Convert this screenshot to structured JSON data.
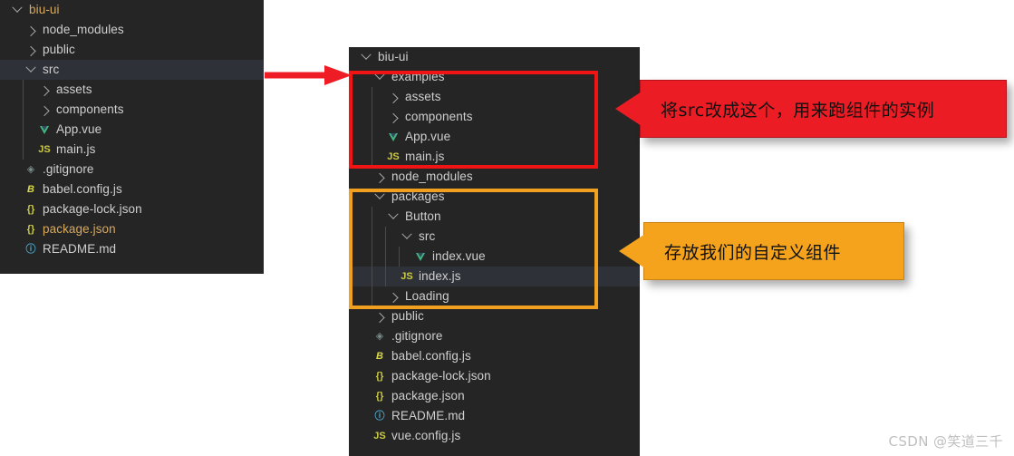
{
  "colors": {
    "panel_bg": "#252526",
    "row_selected": "#2f3138",
    "text": "#cccccc",
    "root_folder": "#d7a95f",
    "highlight_red": "#f01414",
    "highlight_orange": "#f0a01e",
    "callout_red_bg": "#ec1c24",
    "callout_orange_bg": "#f5a31c",
    "vue_icon": "#41b883",
    "js_icon": "#cbcb41"
  },
  "left_panel": {
    "name": "before-explorer",
    "rows": [
      {
        "label": "biu-ui",
        "depth": 0,
        "kind": "folder-open",
        "icon": "chevron-down-icon",
        "color": "root",
        "selected": false
      },
      {
        "label": "node_modules",
        "depth": 1,
        "kind": "folder",
        "icon": "chevron-right-icon",
        "color": "folder",
        "selected": false
      },
      {
        "label": "public",
        "depth": 1,
        "kind": "folder",
        "icon": "chevron-right-icon",
        "color": "folder",
        "selected": false
      },
      {
        "label": "src",
        "depth": 1,
        "kind": "folder-open",
        "icon": "chevron-down-icon",
        "color": "folder",
        "selected": true
      },
      {
        "label": "assets",
        "depth": 2,
        "kind": "folder",
        "icon": "chevron-right-icon",
        "color": "folder",
        "selected": false
      },
      {
        "label": "components",
        "depth": 2,
        "kind": "folder",
        "icon": "chevron-right-icon",
        "color": "folder",
        "selected": false
      },
      {
        "label": "App.vue",
        "depth": 2,
        "kind": "file",
        "icon": "vue-file-icon",
        "color": "file",
        "selected": false
      },
      {
        "label": "main.js",
        "depth": 2,
        "kind": "file",
        "icon": "js-file-icon",
        "color": "file",
        "selected": false
      },
      {
        "label": ".gitignore",
        "depth": 1,
        "kind": "file",
        "icon": "git-file-icon",
        "color": "file",
        "selected": false
      },
      {
        "label": "babel.config.js",
        "depth": 1,
        "kind": "file",
        "icon": "babel-file-icon",
        "color": "file",
        "selected": false
      },
      {
        "label": "package-lock.json",
        "depth": 1,
        "kind": "file",
        "icon": "json-file-icon",
        "color": "file",
        "selected": false
      },
      {
        "label": "package.json",
        "depth": 1,
        "kind": "file",
        "icon": "json-file-icon",
        "color": "pkg",
        "selected": false
      },
      {
        "label": "README.md",
        "depth": 1,
        "kind": "file",
        "icon": "markdown-file-icon",
        "color": "file",
        "selected": false
      }
    ]
  },
  "right_panel": {
    "name": "after-explorer",
    "rows": [
      {
        "label": "biu-ui",
        "depth": 0,
        "kind": "folder-open",
        "icon": "chevron-down-icon",
        "color": "folder",
        "selected": false
      },
      {
        "label": "examples",
        "depth": 1,
        "kind": "folder-open",
        "icon": "chevron-down-icon",
        "color": "folder",
        "selected": false
      },
      {
        "label": "assets",
        "depth": 2,
        "kind": "folder",
        "icon": "chevron-right-icon",
        "color": "folder",
        "selected": false
      },
      {
        "label": "components",
        "depth": 2,
        "kind": "folder",
        "icon": "chevron-right-icon",
        "color": "folder",
        "selected": false
      },
      {
        "label": "App.vue",
        "depth": 2,
        "kind": "file",
        "icon": "vue-file-icon",
        "color": "file",
        "selected": false
      },
      {
        "label": "main.js",
        "depth": 2,
        "kind": "file",
        "icon": "js-file-icon",
        "color": "file",
        "selected": false
      },
      {
        "label": "node_modules",
        "depth": 1,
        "kind": "folder",
        "icon": "chevron-right-icon",
        "color": "folder",
        "selected": false
      },
      {
        "label": "packages",
        "depth": 1,
        "kind": "folder-open",
        "icon": "chevron-down-icon",
        "color": "folder",
        "selected": false
      },
      {
        "label": "Button",
        "depth": 2,
        "kind": "folder-open",
        "icon": "chevron-down-icon",
        "color": "folder",
        "selected": false
      },
      {
        "label": "src",
        "depth": 3,
        "kind": "folder-open",
        "icon": "chevron-down-icon",
        "color": "folder",
        "selected": false
      },
      {
        "label": "index.vue",
        "depth": 4,
        "kind": "file",
        "icon": "vue-file-icon",
        "color": "file",
        "selected": false
      },
      {
        "label": "index.js",
        "depth": 3,
        "kind": "file",
        "icon": "js-file-icon",
        "color": "file",
        "selected": true
      },
      {
        "label": "Loading",
        "depth": 2,
        "kind": "folder",
        "icon": "chevron-right-icon",
        "color": "folder",
        "selected": false
      },
      {
        "label": "public",
        "depth": 1,
        "kind": "folder",
        "icon": "chevron-right-icon",
        "color": "folder",
        "selected": false
      },
      {
        "label": ".gitignore",
        "depth": 1,
        "kind": "file",
        "icon": "git-file-icon",
        "color": "file",
        "selected": false
      },
      {
        "label": "babel.config.js",
        "depth": 1,
        "kind": "file",
        "icon": "babel-file-icon",
        "color": "file",
        "selected": false
      },
      {
        "label": "package-lock.json",
        "depth": 1,
        "kind": "file",
        "icon": "json-file-icon",
        "color": "file",
        "selected": false
      },
      {
        "label": "package.json",
        "depth": 1,
        "kind": "file",
        "icon": "json-file-icon",
        "color": "file",
        "selected": false
      },
      {
        "label": "README.md",
        "depth": 1,
        "kind": "file",
        "icon": "markdown-file-icon",
        "color": "file",
        "selected": false
      },
      {
        "label": "vue.config.js",
        "depth": 1,
        "kind": "file",
        "icon": "js-file-icon",
        "color": "file",
        "selected": false
      }
    ]
  },
  "annotations": {
    "red_callout": {
      "text": "将src改成这个，用来跑组件的实例",
      "target": "examples-folder-group"
    },
    "orange_callout": {
      "text": "存放我们的自定义组件",
      "target": "packages-folder-group"
    },
    "pointer_arrow": {
      "from": "src-row-left-panel",
      "to": "examples-group-right-panel"
    }
  },
  "watermark": {
    "text": "CSDN @笑道三千"
  }
}
